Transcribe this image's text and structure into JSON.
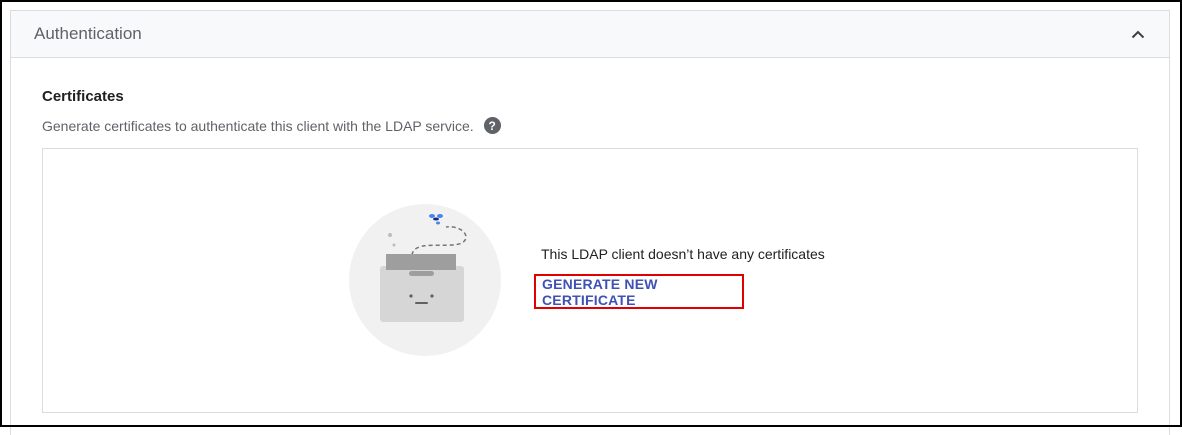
{
  "panel": {
    "title": "Authentication"
  },
  "certificates": {
    "title": "Certificates",
    "description": "Generate certificates to authenticate this client with the LDAP service.",
    "help_icon": "help-icon"
  },
  "empty_state": {
    "illustration": "empty-box-illustration",
    "message": "This LDAP client doesn’t have any certificates",
    "action_label": "GENERATE NEW CERTIFICATE"
  },
  "colors": {
    "link": "#3f51b5",
    "highlight": "#e00000",
    "header_bg": "#f8f9fa"
  }
}
